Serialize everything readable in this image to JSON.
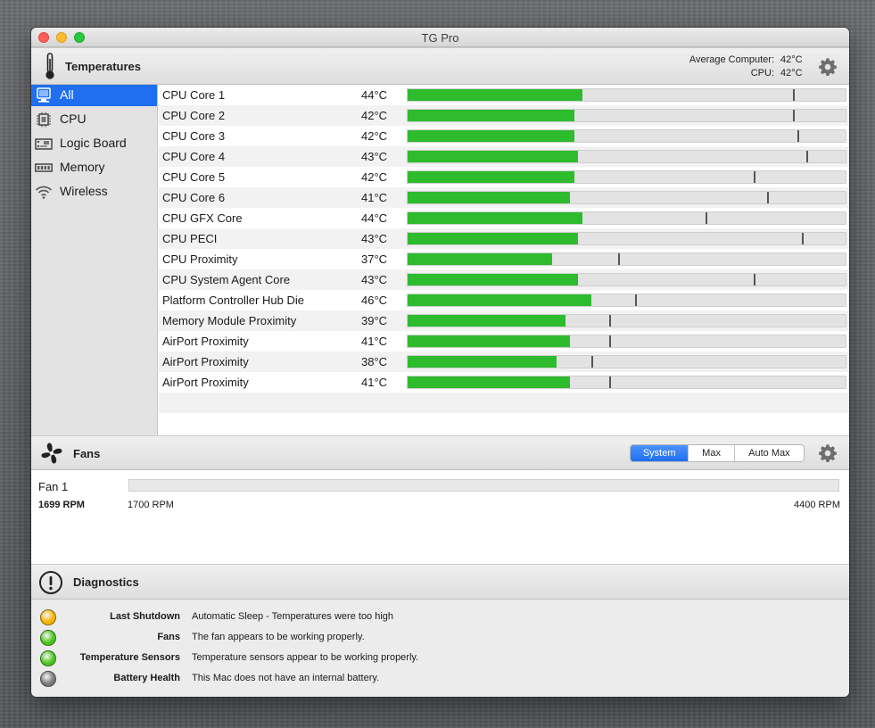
{
  "window": {
    "title": "TG Pro"
  },
  "temperatures": {
    "title": "Temperatures",
    "avg_computer_label": "Average Computer:",
    "avg_computer_value": "42°C",
    "avg_cpu_label": "CPU:",
    "avg_cpu_value": "42°C"
  },
  "sidebar": {
    "items": [
      {
        "label": "All",
        "icon": "computer-icon",
        "selected": true
      },
      {
        "label": "CPU",
        "icon": "chip-icon",
        "selected": false
      },
      {
        "label": "Logic Board",
        "icon": "logic-board-icon",
        "selected": false
      },
      {
        "label": "Memory",
        "icon": "memory-icon",
        "selected": false
      },
      {
        "label": "Wireless",
        "icon": "wifi-icon",
        "selected": false
      }
    ]
  },
  "sensors": [
    {
      "name": "CPU Core 1",
      "temp": "44°C",
      "level": 0.4,
      "marker": 0.88
    },
    {
      "name": "CPU Core 2",
      "temp": "42°C",
      "level": 0.38,
      "marker": 0.88
    },
    {
      "name": "CPU Core 3",
      "temp": "42°C",
      "level": 0.38,
      "marker": 0.89
    },
    {
      "name": "CPU Core 4",
      "temp": "43°C",
      "level": 0.39,
      "marker": 0.91
    },
    {
      "name": "CPU Core 5",
      "temp": "42°C",
      "level": 0.38,
      "marker": 0.79
    },
    {
      "name": "CPU Core 6",
      "temp": "41°C",
      "level": 0.37,
      "marker": 0.82
    },
    {
      "name": "CPU GFX Core",
      "temp": "44°C",
      "level": 0.4,
      "marker": 0.68
    },
    {
      "name": "CPU PECI",
      "temp": "43°C",
      "level": 0.39,
      "marker": 0.9
    },
    {
      "name": "CPU Proximity",
      "temp": "37°C",
      "level": 0.33,
      "marker": 0.48
    },
    {
      "name": "CPU System Agent Core",
      "temp": "43°C",
      "level": 0.39,
      "marker": 0.79
    },
    {
      "name": "Platform Controller Hub Die",
      "temp": "46°C",
      "level": 0.42,
      "marker": 0.52
    },
    {
      "name": "Memory Module Proximity",
      "temp": "39°C",
      "level": 0.36,
      "marker": 0.46
    },
    {
      "name": "AirPort Proximity",
      "temp": "41°C",
      "level": 0.37,
      "marker": 0.46
    },
    {
      "name": "AirPort Proximity",
      "temp": "38°C",
      "level": 0.34,
      "marker": 0.42
    },
    {
      "name": "AirPort Proximity",
      "temp": "41°C",
      "level": 0.37,
      "marker": 0.46
    }
  ],
  "fans": {
    "title": "Fans",
    "modes": [
      {
        "label": "System",
        "active": true
      },
      {
        "label": "Max",
        "active": false
      },
      {
        "label": "Auto Max",
        "active": false
      }
    ],
    "fan1": {
      "name": "Fan 1",
      "current_rpm": "1699 RPM",
      "min_rpm": "1700 RPM",
      "max_rpm": "4400 RPM",
      "level": 0
    }
  },
  "diagnostics": {
    "title": "Diagnostics",
    "items": [
      {
        "label": "Last Shutdown",
        "value": "Automatic Sleep - Temperatures were too high",
        "status": "warning",
        "color": "#f5b301"
      },
      {
        "label": "Fans",
        "value": "The fan appears to be working properly.",
        "status": "ok",
        "color": "#4cc41f"
      },
      {
        "label": "Temperature Sensors",
        "value": "Temperature sensors appear to be working properly.",
        "status": "ok",
        "color": "#4cc41f"
      },
      {
        "label": "Battery Health",
        "value": "This Mac does not have an internal battery.",
        "status": "none",
        "color": "#7a7a7a"
      }
    ]
  },
  "colors": {
    "accent": "#1f6ff0",
    "bar_fill": "#2ebb2e",
    "bar_track": "#e3e3e3"
  }
}
